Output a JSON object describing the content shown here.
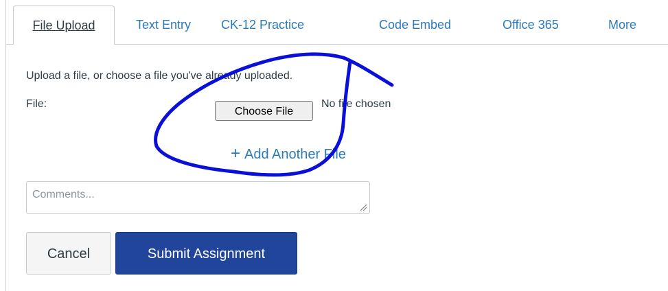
{
  "tabs": [
    {
      "label": "File Upload",
      "active": true
    },
    {
      "label": "Text Entry",
      "active": false
    },
    {
      "label": "CK-12 Practice",
      "active": false
    },
    {
      "label": "Code Embed",
      "active": false
    },
    {
      "label": "Office 365",
      "active": false
    },
    {
      "label": "More",
      "active": false
    }
  ],
  "upload": {
    "instructions": "Upload a file, or choose a file you've already uploaded.",
    "file_label": "File:",
    "choose_file_label": "Choose File",
    "no_file_text": "No file chosen",
    "add_another_label": "Add Another File",
    "add_icon": "plus-icon"
  },
  "comments": {
    "placeholder": "Comments...",
    "value": ""
  },
  "actions": {
    "cancel_label": "Cancel",
    "submit_label": "Submit Assignment"
  },
  "colors": {
    "link": "#2b7abc",
    "submit_bg": "#21459a",
    "annotation_ink": "#0a10d8"
  }
}
